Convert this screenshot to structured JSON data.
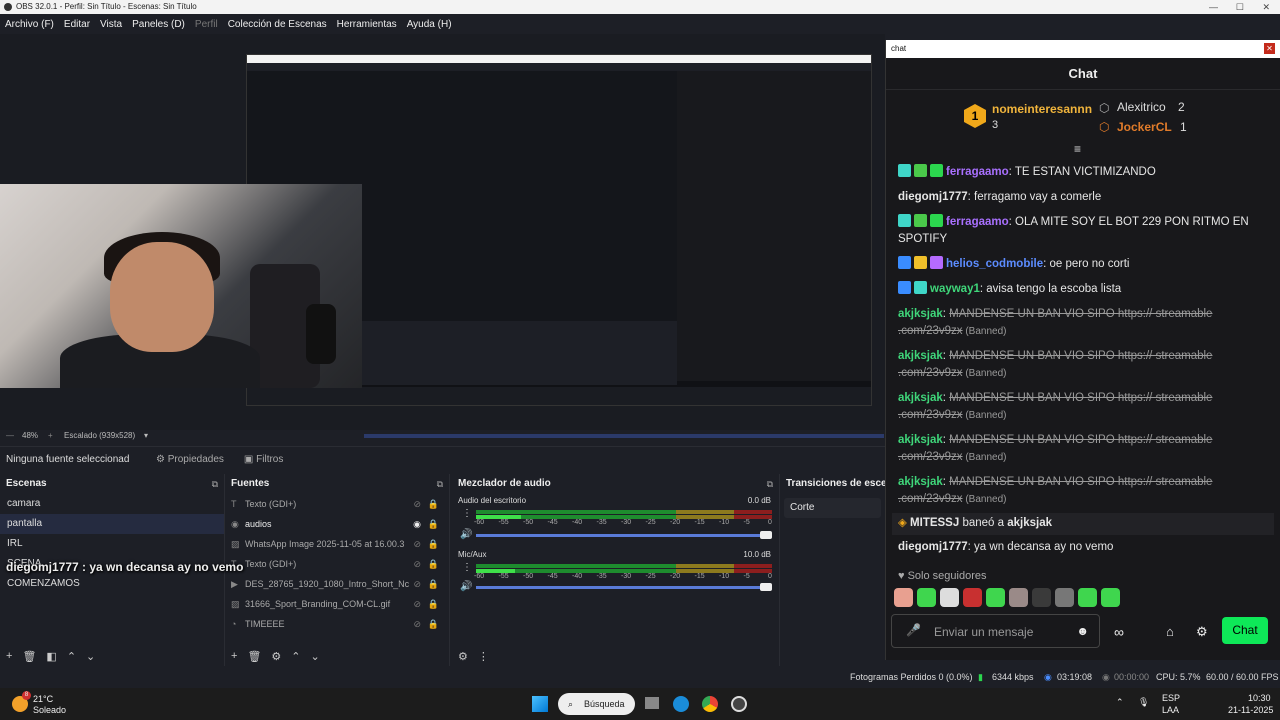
{
  "window": {
    "title": "OBS 32.0.1 - Perfil: Sin Título - Escenas: Sin Título"
  },
  "menu": [
    "Archivo (F)",
    "Editar",
    "Vista",
    "Paneles (D)",
    "Perfil",
    "Colección de Escenas",
    "Herramientas",
    "Ayuda (H)"
  ],
  "preview": {
    "zoom": "48%",
    "scaled": "Escalado (939x528)"
  },
  "properties_bar": {
    "no_source": "Ninguna fuente seleccionad",
    "properties": "Propiedades",
    "filters": "Filtros"
  },
  "scenes": {
    "title": "Escenas",
    "items": [
      "camara",
      "pantalla",
      "IRL",
      "SCENA",
      "COMENZAMOS"
    ]
  },
  "sources": {
    "title": "Fuentes",
    "items": [
      "Texto (GDI+)",
      "audios",
      "WhatsApp Image 2025-11-05 at 16.00.3",
      "Texto (GDI+)",
      "DES_28765_1920_1080_Intro_Short_Nc",
      "31666_Sport_Branding_COM-CL.gif",
      "TIMEEEE"
    ]
  },
  "mixer": {
    "title": "Mezclador de audio",
    "channels": [
      {
        "name": "Audio del escritorio",
        "db": "0.0 dB",
        "level": 0.75
      },
      {
        "name": "Mic/Aux",
        "db": "10.0 dB",
        "level": 0.65
      }
    ],
    "scale": [
      "-60",
      "-55",
      "-50",
      "-45",
      "-40",
      "-35",
      "-30",
      "-25",
      "-20",
      "-15",
      "-10",
      "-5",
      "0"
    ]
  },
  "transitions": {
    "title": "Transiciones de escena",
    "current": "Corte"
  },
  "overlay_text": "diegomj1777 : ya wn decansa ay no vemo",
  "chat": {
    "window_title": "chat",
    "header": "Chat",
    "leaderboard": {
      "first": {
        "name": "nomeinteresannn",
        "rank": "1",
        "count": "3"
      },
      "second": {
        "name": "Alexitrico",
        "count": "2"
      },
      "third": {
        "name": "JockerCL",
        "count": "1"
      }
    },
    "messages": [
      {
        "user": "ferragaamo",
        "color": "#a970ff",
        "text": ": TE ESTAN VICTIMIZANDO"
      },
      {
        "user": "diegomj1777",
        "color": "#e6e6e6",
        "text": ": ferragamo vay a comerle"
      },
      {
        "user": "ferragaamo",
        "color": "#a970ff",
        "text": ": OLA MITE SOY EL BOT 229 PON RITMO EN SPOTIFY"
      },
      {
        "user": "helios_codmobile",
        "color": "#5c8cff",
        "text": ": oe pero no corti"
      },
      {
        "user": "wayway1",
        "color": "#3fd67a",
        "text": ": avisa tengo la escoba lista"
      },
      {
        "user": "akjksjak",
        "color": "#3fd67a",
        "text": "MANDENSE UN BAN VIO SIPO https:// streamable .com/23v9zx",
        "banned": "(Banned)"
      },
      {
        "user": "akjksjak",
        "color": "#3fd67a",
        "text": "MANDENSE UN BAN VIO SIPO https:// streamable .com/23v9zx",
        "banned": "(Banned)"
      },
      {
        "user": "akjksjak",
        "color": "#3fd67a",
        "text": "MANDENSE UN BAN VIO SIPO https:// streamable .com/23v9zx",
        "banned": "(Banned)"
      },
      {
        "user": "akjksjak",
        "color": "#3fd67a",
        "text": "MANDENSE UN BAN VIO SIPO https:// streamable .com/23v9zx",
        "banned": "(Banned)"
      },
      {
        "user": "akjksjak",
        "color": "#3fd67a",
        "text": "MANDENSE UN BAN VIO SIPO https:// streamable .com/23v9zx",
        "banned": "(Banned)"
      }
    ],
    "mod_notice": {
      "mod": "MITESSJ",
      "action": "baneó a",
      "target": "akjksjak"
    },
    "last_message": {
      "user": "diegomj1777",
      "text": ": ya wn decansa ay no vemo"
    },
    "followers_only": "Solo seguidores",
    "input_placeholder": "Enviar un mensaje",
    "send": "Chat"
  },
  "status": {
    "dropped": "Fotogramas Perdidos 0 (0.0%)",
    "kbps": "6344 kbps",
    "live": "03:19:08",
    "rec": "00:00:00",
    "cpu": "CPU: 5.7%",
    "fps": "60.00 / 60.00 FPS"
  },
  "taskbar": {
    "temp": "21°C",
    "weather": "Soleado",
    "search": "Búsqueda",
    "lang1": "ESP",
    "lang2": "LAA",
    "time": "10:30",
    "date": "21-11-2025",
    "notif": "8"
  }
}
